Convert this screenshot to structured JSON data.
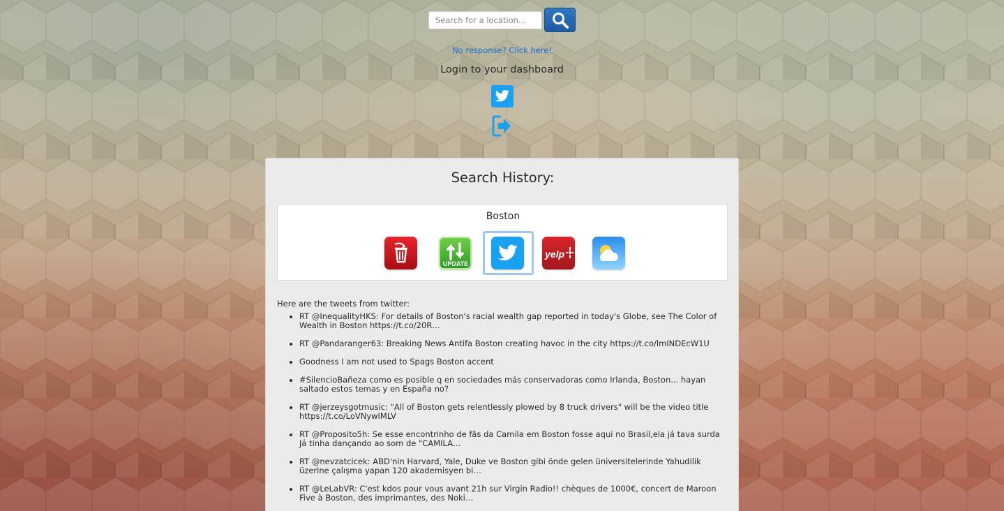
{
  "search": {
    "placeholder": "Search for a location...",
    "button_icon": "magnifier-icon"
  },
  "no_response_link": "No response? Click here!",
  "login": {
    "title": "Login to your dashboard",
    "twitter_icon": "twitter-icon",
    "logout_icon": "sign-out-icon"
  },
  "history": {
    "title": "Search History:",
    "entries": [
      {
        "location": "Boston",
        "actions": [
          {
            "icon": "trash-icon",
            "label": ""
          },
          {
            "icon": "update-icon",
            "label": "UPDATE"
          },
          {
            "icon": "twitter-icon",
            "label": "",
            "selected": true
          },
          {
            "icon": "yelp-icon",
            "label": "yelp"
          },
          {
            "icon": "weather-icon",
            "label": ""
          }
        ]
      }
    ]
  },
  "tweets": {
    "intro": "Here are the tweets from twitter:",
    "items": [
      "RT @InequalityHKS: For details of Boston's racial wealth gap reported in today's Globe, see The Color of Wealth in Boston https://t.co/20R…",
      "RT @Pandaranger63: Breaking News Antifa Boston creating havoc in the city https://t.co/lmINDEcW1U",
      "Goodness I am not used to Spags Boston accent",
      "#SilencioBañeza como es posible q en sociedades más conservadoras como Irlanda, Boston... hayan saltado estos temas y en España no?",
      "RT @jerzeysgotmusic: \"All of Boston gets relentlessly plowed by 8 truck drivers\" will be the video title https://t.co/LoVNywIMLV",
      "RT @Proposito5h: Se esse encontrinho de fãs da Camila em Boston fosse aqui no Brasil,ela já tava surda Já tinha dançando ao som de \"CAMILA…",
      "RT @nevzatcicek: ABD'nin Harvard, Yale, Duke ve Boston gibi önde gelen üniversitelerinde Yahudilik üzerine çalışma yapan 120 akademisyen bi…",
      "RT @LeLabVR: C'est kdos pour vous avant 21h sur Virgin Radio!! chèques de 1000€, concert de Maroon Five à Boston, des imprimantes, des Noki…"
    ]
  },
  "colors": {
    "link": "#1e6fd0",
    "twitter_blue": "#1ba1f2",
    "search_button": "#2f77c2",
    "selected_border": "#9ec8f4"
  }
}
